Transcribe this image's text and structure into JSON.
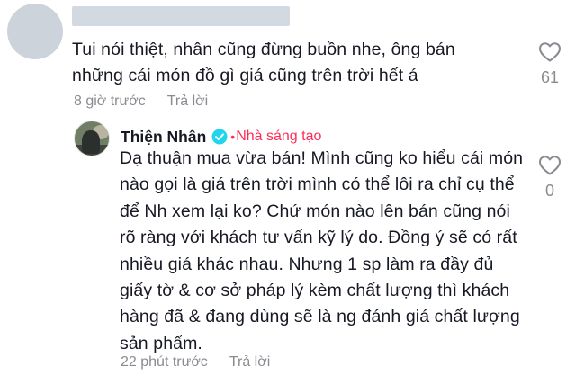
{
  "comment": {
    "text": "Tui nói thiệt, nhân cũng đừng buồn nhe, ông bán những cái món đồ gì giá cũng trên trời hết á",
    "time": "8 giờ trước",
    "reply_label": "Trả lời",
    "like_count": "61",
    "like_icon": "heart-outline-icon"
  },
  "reply": {
    "author": "Thiện Nhân",
    "verified_icon": "verified-check-icon",
    "separator": "•",
    "badge": "Nhà sáng tạo",
    "text": "Dạ thuận mua vừa bán! Mình cũng ko hiểu cái món nào gọi là giá trên trời mình có thể lôi ra chỉ cụ thể để Nh xem lại ko? Chứ món nào lên bán cũng nói rõ ràng với khách tư vấn kỹ lý do. Đồng ý sẽ có rất nhiều giá khác nhau. Nhưng 1 sp làm ra đầy đủ giấy tờ & cơ sở pháp lý kèm chất lượng thì khách hàng đã & đang dùng sẽ là ng đánh giá chất lượng sản phẩm.",
    "time": "22 phút trước",
    "reply_label": "Trả lời",
    "like_count": "0",
    "like_icon": "heart-outline-icon"
  },
  "colors": {
    "accent": "#fe2c55",
    "verified": "#20d5ec",
    "muted": "#8a8b91",
    "text": "#161823"
  }
}
